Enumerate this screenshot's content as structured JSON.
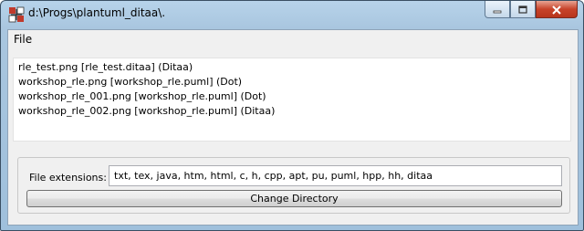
{
  "window": {
    "title": "d:\\Progs\\plantuml_ditaa\\."
  },
  "menu": {
    "file_label": "File"
  },
  "files": [
    "rle_test.png [rle_test.ditaa] (Ditaa)",
    "workshop_rle.png [workshop_rle.puml] (Dot)",
    "workshop_rle_001.png [workshop_rle.puml] (Dot)",
    "workshop_rle_002.png [workshop_rle.puml] (Ditaa)"
  ],
  "extensions": {
    "label": "File extensions:",
    "value": "txt, tex, java, htm, html, c, h, cpp, apt, pu, puml, hpp, hh, ditaa"
  },
  "buttons": {
    "change_directory": "Change Directory"
  },
  "icons": {
    "app": "plantuml-app-icon",
    "minimize": "minimize-icon",
    "maximize": "maximize-icon",
    "close": "close-icon"
  }
}
